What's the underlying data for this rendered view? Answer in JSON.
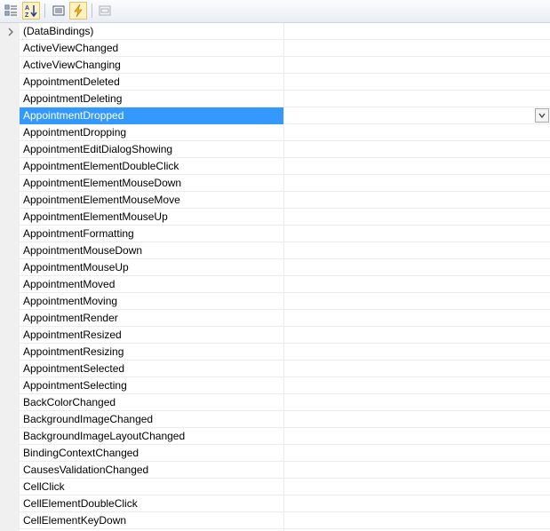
{
  "toolbar": {
    "buttons": [
      {
        "name": "categorized-view-icon",
        "active": false
      },
      {
        "name": "alphabetical-sort-icon",
        "active": true
      },
      {
        "name": "properties-icon",
        "active": false
      },
      {
        "name": "events-icon",
        "active": true
      },
      {
        "name": "property-pages-icon",
        "active": false
      }
    ]
  },
  "grid": {
    "selected_index": 5,
    "rows": [
      {
        "label": "(DataBindings)",
        "expandable": true
      },
      {
        "label": "ActiveViewChanged"
      },
      {
        "label": "ActiveViewChanging"
      },
      {
        "label": "AppointmentDeleted"
      },
      {
        "label": "AppointmentDeleting"
      },
      {
        "label": "AppointmentDropped"
      },
      {
        "label": "AppointmentDropping"
      },
      {
        "label": "AppointmentEditDialogShowing"
      },
      {
        "label": "AppointmentElementDoubleClick"
      },
      {
        "label": "AppointmentElementMouseDown"
      },
      {
        "label": "AppointmentElementMouseMove"
      },
      {
        "label": "AppointmentElementMouseUp"
      },
      {
        "label": "AppointmentFormatting"
      },
      {
        "label": "AppointmentMouseDown"
      },
      {
        "label": "AppointmentMouseUp"
      },
      {
        "label": "AppointmentMoved"
      },
      {
        "label": "AppointmentMoving"
      },
      {
        "label": "AppointmentRender"
      },
      {
        "label": "AppointmentResized"
      },
      {
        "label": "AppointmentResizing"
      },
      {
        "label": "AppointmentSelected"
      },
      {
        "label": "AppointmentSelecting"
      },
      {
        "label": "BackColorChanged"
      },
      {
        "label": "BackgroundImageChanged"
      },
      {
        "label": "BackgroundImageLayoutChanged"
      },
      {
        "label": "BindingContextChanged"
      },
      {
        "label": "CausesValidationChanged"
      },
      {
        "label": "CellClick"
      },
      {
        "label": "CellElementDoubleClick"
      },
      {
        "label": "CellElementKeyDown"
      }
    ]
  },
  "colors": {
    "selection": "#3399ff",
    "gutter": "#f0f0f0",
    "gridline": "#ececec"
  }
}
